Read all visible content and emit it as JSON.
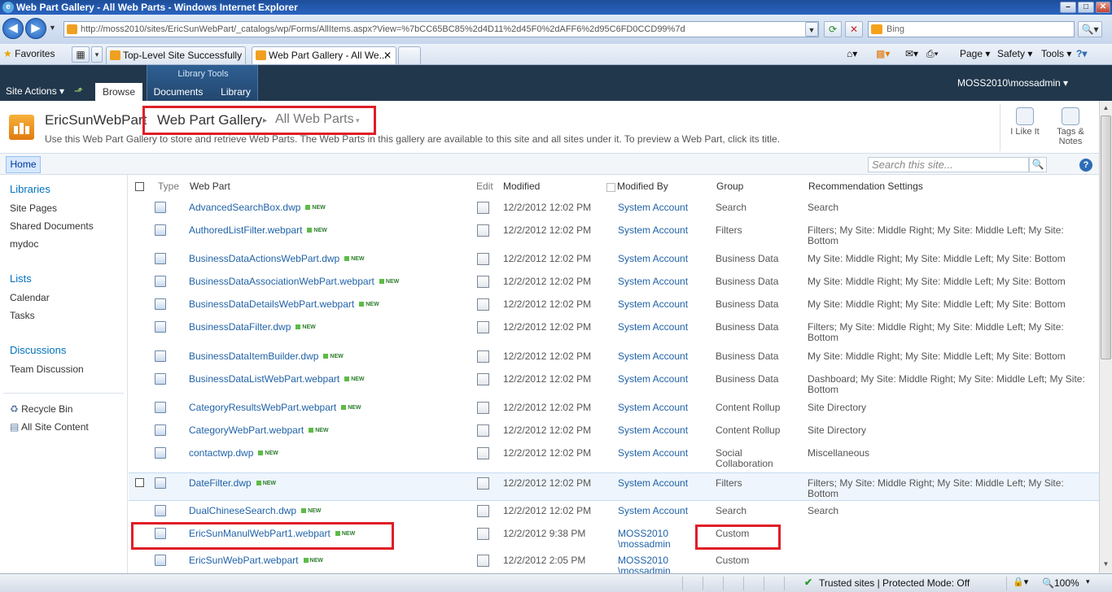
{
  "window": {
    "title": "Web Part Gallery - All Web Parts - Windows Internet Explorer"
  },
  "browser": {
    "url": "http://moss2010/sites/EricSunWebPart/_catalogs/wp/Forms/AllItems.aspx?View=%7bCC65BC85%2d4D11%2d45F0%2dAFF6%2d95C6FD0CCD99%7d",
    "search_placeholder": "Bing",
    "favorites_label": "Favorites",
    "tabs": [
      {
        "label": "Top-Level Site Successfully ..."
      },
      {
        "label": "Web Part Gallery - All We..."
      }
    ],
    "commands": {
      "page": "Page ▾",
      "safety": "Safety ▾",
      "tools": "Tools ▾"
    }
  },
  "ribbon": {
    "site_actions": "Site Actions ▾",
    "library_tools": "Library Tools",
    "tabs": {
      "browse": "Browse",
      "documents": "Documents",
      "library": "Library"
    },
    "user": "MOSS2010\\mossadmin ▾"
  },
  "title_area": {
    "site_name": "EricSunWebPart",
    "gallery": "Web Part Gallery",
    "view": "All Web Parts",
    "description": "Use this Web Part Gallery to store and retrieve Web Parts. The Web Parts in this gallery are available to this site and all sites under it. To preview a Web Part, click its title.",
    "i_like_it": "I Like It",
    "tags_notes_1": "Tags &",
    "tags_notes_2": "Notes"
  },
  "topnav": {
    "home": "Home",
    "search_placeholder": "Search this site..."
  },
  "leftnav": {
    "libraries": "Libraries",
    "library_items": [
      "Site Pages",
      "Shared Documents",
      "mydoc"
    ],
    "lists": "Lists",
    "list_items": [
      "Calendar",
      "Tasks"
    ],
    "discussions": "Discussions",
    "discussion_items": [
      "Team Discussion"
    ],
    "recycle_bin": "Recycle Bin",
    "all_site_content": "All Site Content"
  },
  "list": {
    "headers": {
      "type": "Type",
      "web_part": "Web Part",
      "edit": "Edit",
      "modified": "Modified",
      "modified_by": "Modified By",
      "group": "Group",
      "recommendation": "Recommendation Settings"
    },
    "new_label": "NEW",
    "rows": [
      {
        "name": "AdvancedSearchBox.dwp",
        "modified": "12/2/2012 12:02 PM",
        "by": "System Account",
        "group": "Search",
        "rec": "Search"
      },
      {
        "name": "AuthoredListFilter.webpart",
        "modified": "12/2/2012 12:02 PM",
        "by": "System Account",
        "group": "Filters",
        "rec": "Filters; My Site: Middle Right; My Site: Middle Left; My Site: Bottom"
      },
      {
        "name": "BusinessDataActionsWebPart.dwp",
        "modified": "12/2/2012 12:02 PM",
        "by": "System Account",
        "group": "Business Data",
        "rec": "My Site: Middle Right; My Site: Middle Left; My Site: Bottom"
      },
      {
        "name": "BusinessDataAssociationWebPart.webpart",
        "modified": "12/2/2012 12:02 PM",
        "by": "System Account",
        "group": "Business Data",
        "rec": "My Site: Middle Right; My Site: Middle Left; My Site: Bottom"
      },
      {
        "name": "BusinessDataDetailsWebPart.webpart",
        "modified": "12/2/2012 12:02 PM",
        "by": "System Account",
        "group": "Business Data",
        "rec": "My Site: Middle Right; My Site: Middle Left; My Site: Bottom"
      },
      {
        "name": "BusinessDataFilter.dwp",
        "modified": "12/2/2012 12:02 PM",
        "by": "System Account",
        "group": "Business Data",
        "rec": "Filters; My Site: Middle Right; My Site: Middle Left; My Site: Bottom"
      },
      {
        "name": "BusinessDataItemBuilder.dwp",
        "modified": "12/2/2012 12:02 PM",
        "by": "System Account",
        "group": "Business Data",
        "rec": "My Site: Middle Right; My Site: Middle Left; My Site: Bottom"
      },
      {
        "name": "BusinessDataListWebPart.webpart",
        "modified": "12/2/2012 12:02 PM",
        "by": "System Account",
        "group": "Business Data",
        "rec": "Dashboard; My Site: Middle Right; My Site: Middle Left; My Site: Bottom"
      },
      {
        "name": "CategoryResultsWebPart.webpart",
        "modified": "12/2/2012 12:02 PM",
        "by": "System Account",
        "group": "Content Rollup",
        "rec": "Site Directory"
      },
      {
        "name": "CategoryWebPart.webpart",
        "modified": "12/2/2012 12:02 PM",
        "by": "System Account",
        "group": "Content Rollup",
        "rec": "Site Directory"
      },
      {
        "name": "contactwp.dwp",
        "modified": "12/2/2012 12:02 PM",
        "by": "System Account",
        "group": "Social Collaboration",
        "rec": "Miscellaneous"
      },
      {
        "name": "DateFilter.dwp",
        "modified": "12/2/2012 12:02 PM",
        "by": "System Account",
        "group": "Filters",
        "rec": "Filters; My Site: Middle Right; My Site: Middle Left; My Site: Bottom"
      },
      {
        "name": "DualChineseSearch.dwp",
        "modified": "12/2/2012 12:02 PM",
        "by": "System Account",
        "group": "Search",
        "rec": "Search"
      },
      {
        "name": "EricSunManulWebPart1.webpart",
        "modified": "12/2/2012 9:38 PM",
        "by": "MOSS2010 \\mossadmin",
        "group": "Custom",
        "rec": ""
      },
      {
        "name": "EricSunWebPart.webpart",
        "modified": "12/2/2012 2:05 PM",
        "by": "MOSS2010 \\mossadmin",
        "group": "Custom",
        "rec": ""
      }
    ]
  },
  "status": {
    "zone": "Trusted sites | Protected Mode: Off",
    "zoom": "100%"
  }
}
